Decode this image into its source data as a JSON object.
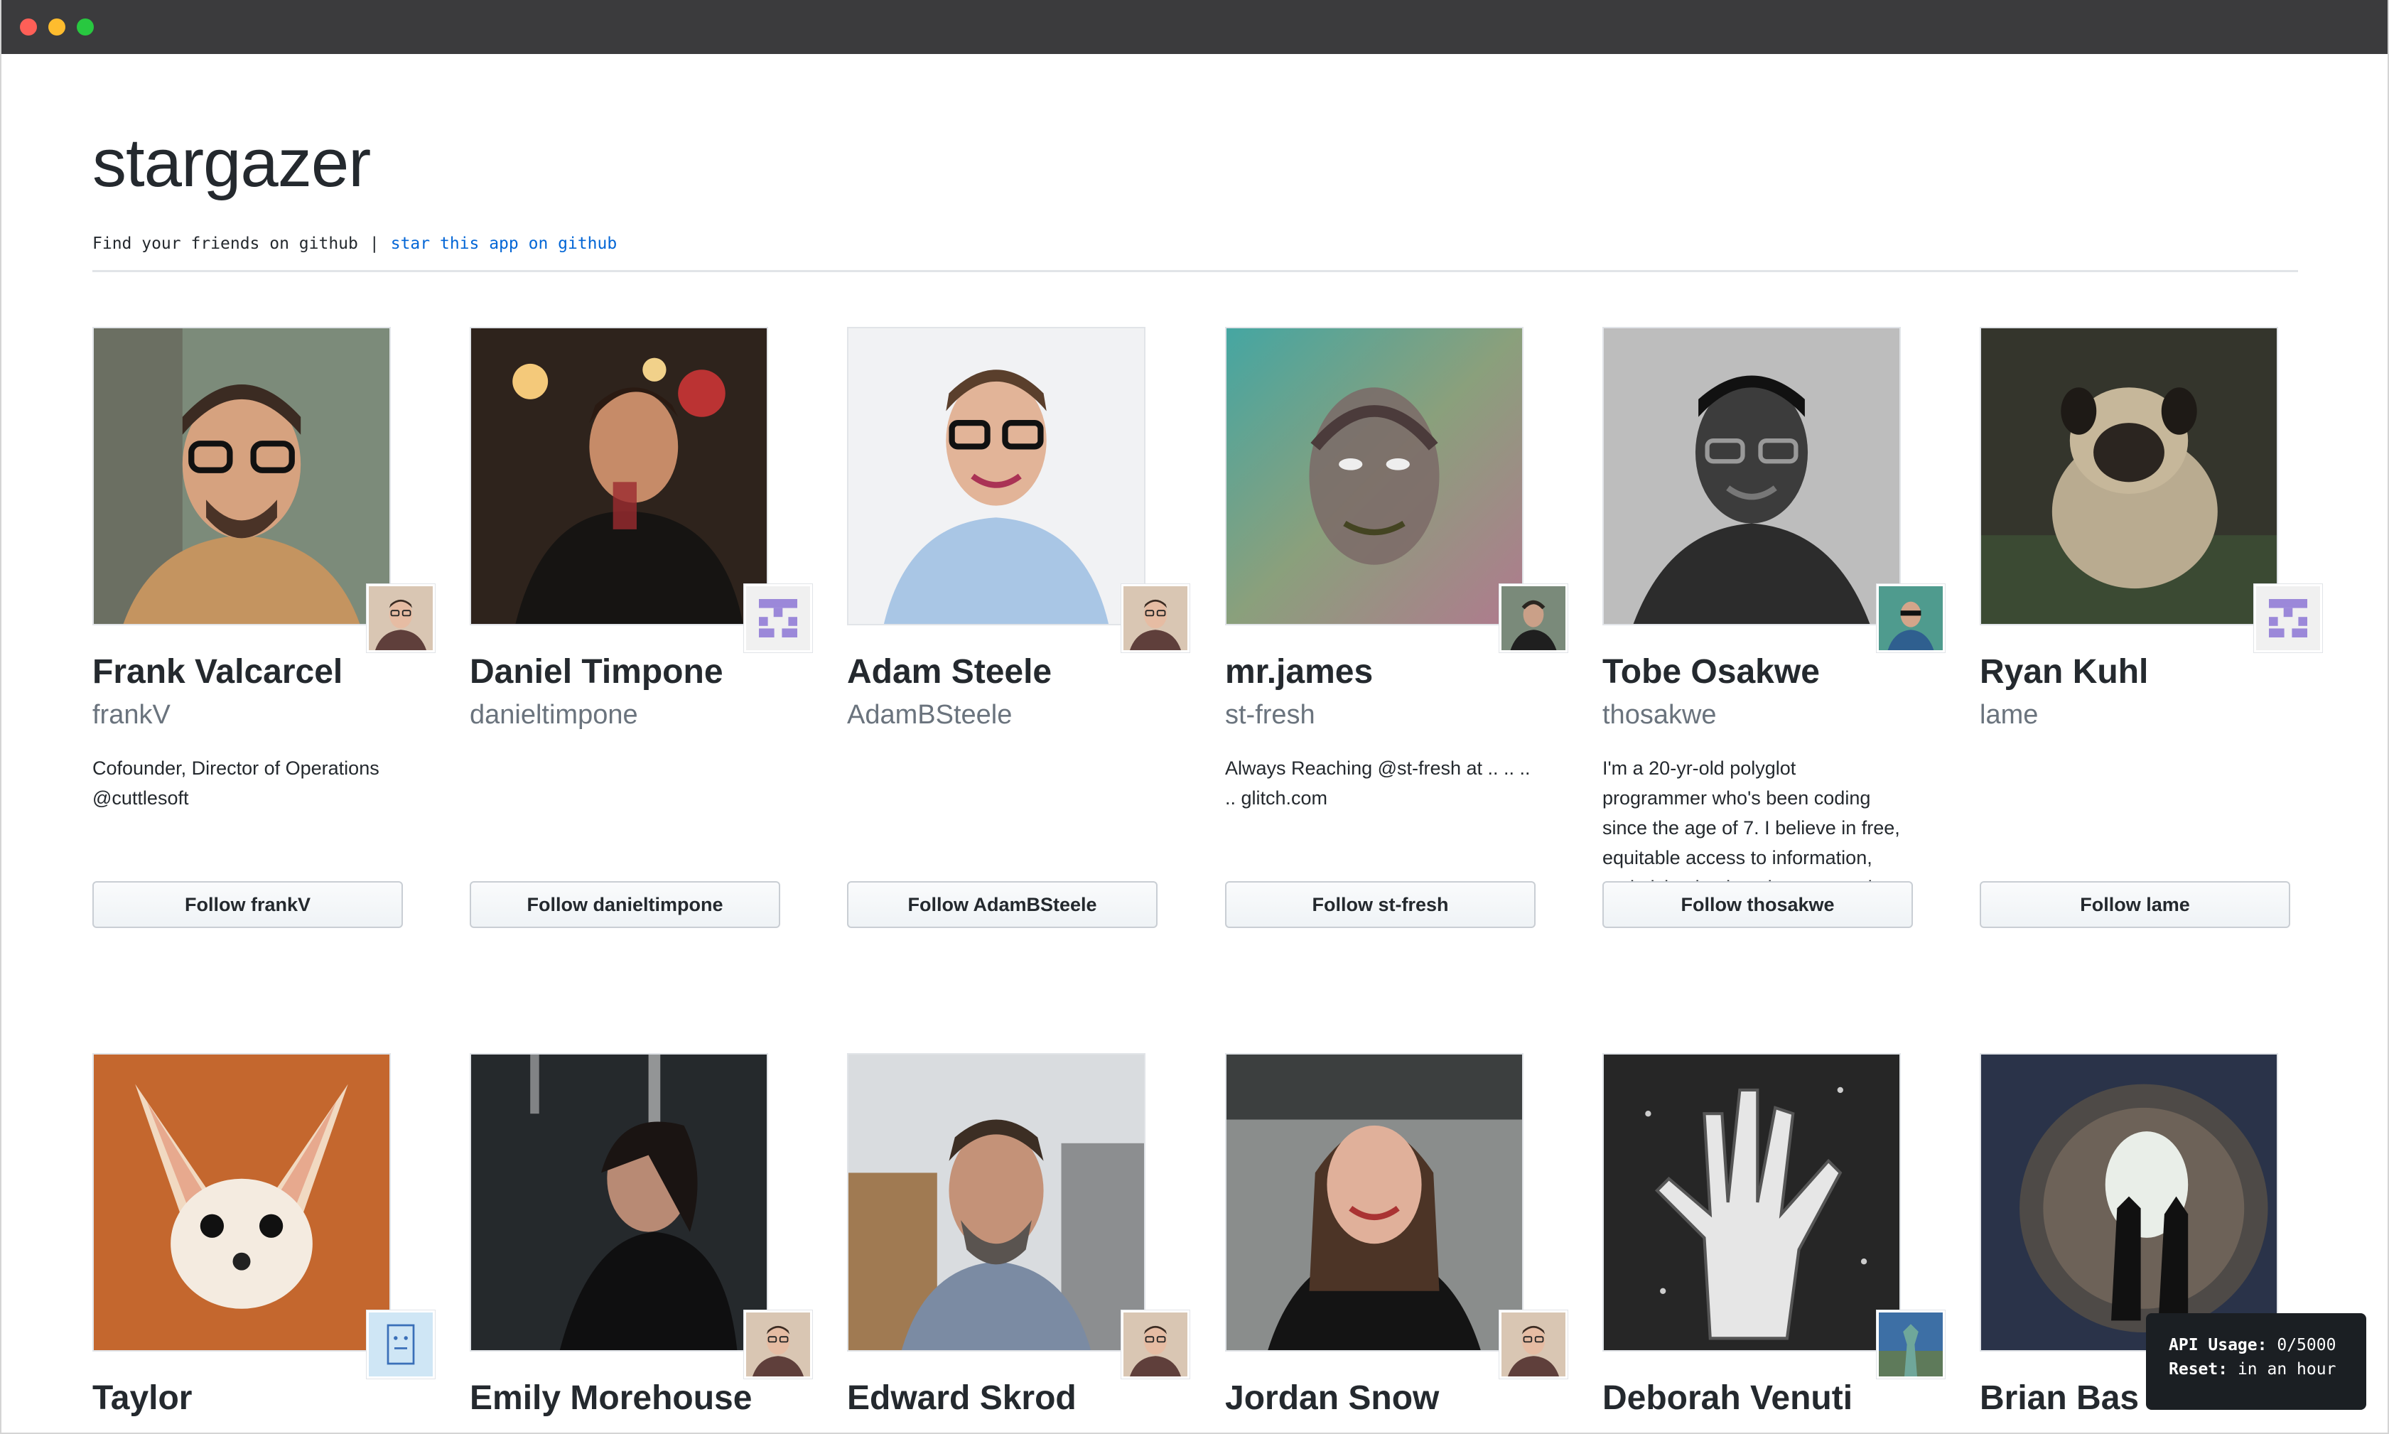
{
  "window": {
    "controls": [
      "close",
      "minimize",
      "maximize"
    ]
  },
  "header": {
    "title": "stargazer",
    "tagline": "Find your friends on github",
    "separator": "|",
    "star_link": "star this app on github"
  },
  "colors": {
    "link": "#0366d6",
    "text": "#24292e",
    "muted": "#6a737d",
    "button_border": "#c9ced4"
  },
  "users": [
    {
      "name": "Frank Valcarcel",
      "login": "frankV",
      "bio_lines": [
        "Cofounder, Director of Operations",
        "@cuttlesoft"
      ],
      "follow": "Follow frankV",
      "photo_icon": "man-glasses-beard-portrait",
      "mini_icon": "man-glasses-avatar"
    },
    {
      "name": "Daniel Timpone",
      "login": "danieltimpone",
      "bio_lines": [],
      "follow": "Follow danieltimpone",
      "photo_icon": "man-holding-wine-glass-portrait",
      "mini_icon": "identicon-purple"
    },
    {
      "name": "Adam Steele",
      "login": "AdamBSteele",
      "bio_lines": [],
      "follow": "Follow AdamBSteele",
      "photo_icon": "man-glasses-blue-shirt-portrait",
      "mini_icon": "man-glasses-avatar"
    },
    {
      "name": "mr.james",
      "login": "st-fresh",
      "bio_lines": [
        "Always Reaching @st-fresh at .. .. ..",
        ".. glitch.com"
      ],
      "follow": "Follow st-fresh",
      "photo_icon": "man-looking-up-gradient-portrait",
      "mini_icon": "man-outdoor-avatar"
    },
    {
      "name": "Tobe Osakwe",
      "login": "thosakwe",
      "bio_lines": [
        "I'm a 20-yr-old polyglot",
        "programmer who's been coding",
        "since the age of 7. I believe in free,",
        "equitable access to information,",
        "and giving back to the community."
      ],
      "follow": "Follow thosakwe",
      "photo_icon": "man-glasses-grayscale-portrait",
      "mini_icon": "man-sunglasses-avatar"
    },
    {
      "name": "Ryan Kuhl",
      "login": "lame",
      "bio_lines": [],
      "follow": "Follow lame",
      "photo_icon": "pug-dog-photo",
      "mini_icon": "identicon-purple"
    },
    {
      "name": "Taylor",
      "login": "",
      "bio_lines": [],
      "follow": "",
      "photo_icon": "fennec-fox-photo",
      "mini_icon": "sketch-drawing-avatar"
    },
    {
      "name": "Emily Morehouse",
      "login": "",
      "bio_lines": [],
      "follow": "",
      "photo_icon": "woman-dark-room-portrait",
      "mini_icon": "man-glasses-avatar"
    },
    {
      "name": "Edward Skrod",
      "login": "",
      "bio_lines": [],
      "follow": "",
      "photo_icon": "man-beard-braid-portrait",
      "mini_icon": "man-glasses-avatar"
    },
    {
      "name": "Jordan Snow",
      "login": "",
      "bio_lines": [],
      "follow": "",
      "photo_icon": "woman-smiling-portrait",
      "mini_icon": "man-glasses-avatar"
    },
    {
      "name": "Deborah Venuti",
      "login": "",
      "bio_lines": [],
      "follow": "",
      "photo_icon": "hand-drawing-bw-photo",
      "mini_icon": "statue-avatar"
    },
    {
      "name": "Brian Bas",
      "login": "",
      "bio_lines": [],
      "follow": "",
      "photo_icon": "tunnel-silhouettes-photo",
      "mini_icon": ""
    }
  ],
  "api_usage": {
    "usage_label": "API Usage:",
    "usage_value": "0/5000",
    "reset_label": "Reset:",
    "reset_value": "in an hour"
  }
}
